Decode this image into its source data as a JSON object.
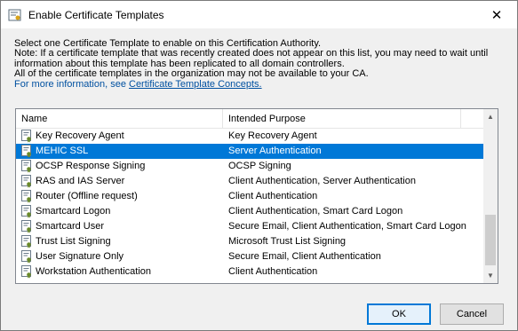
{
  "window": {
    "title": "Enable Certificate Templates",
    "close_glyph": "✕"
  },
  "description": {
    "line1": "Select one Certificate Template to enable on this Certification Authority.",
    "line2": "Note: If a certificate template that was recently created does not appear on this list, you may need to wait until",
    "line3": "information about this template has been replicated to all domain controllers.",
    "line4": "All of the certificate templates in the organization may not be available to your CA.",
    "more_info_prefix": "For more information, see ",
    "more_info_link": "Certificate Template Concepts."
  },
  "list": {
    "columns": {
      "name": "Name",
      "purpose": "Intended Purpose"
    },
    "rows": [
      {
        "name": "Key Recovery Agent",
        "purpose": "Key Recovery Agent",
        "selected": false
      },
      {
        "name": "MEHIC SSL",
        "purpose": "Server Authentication",
        "selected": true
      },
      {
        "name": "OCSP Response Signing",
        "purpose": "OCSP Signing",
        "selected": false
      },
      {
        "name": "RAS and IAS Server",
        "purpose": "Client Authentication, Server Authentication",
        "selected": false
      },
      {
        "name": "Router (Offline request)",
        "purpose": "Client Authentication",
        "selected": false
      },
      {
        "name": "Smartcard Logon",
        "purpose": "Client Authentication, Smart Card Logon",
        "selected": false
      },
      {
        "name": "Smartcard User",
        "purpose": "Secure Email, Client Authentication, Smart Card Logon",
        "selected": false
      },
      {
        "name": "Trust List Signing",
        "purpose": "Microsoft Trust List Signing",
        "selected": false
      },
      {
        "name": "User Signature Only",
        "purpose": "Secure Email, Client Authentication",
        "selected": false
      },
      {
        "name": "Workstation Authentication",
        "purpose": "Client Authentication",
        "selected": false
      }
    ],
    "scroll_up_glyph": "▲",
    "scroll_down_glyph": "▼"
  },
  "buttons": {
    "ok": "OK",
    "cancel": "Cancel"
  },
  "colors": {
    "selection": "#0078d7",
    "link": "#0050a0"
  },
  "icons": {
    "app": "certificate-icon",
    "row": "certificate-template-icon"
  }
}
